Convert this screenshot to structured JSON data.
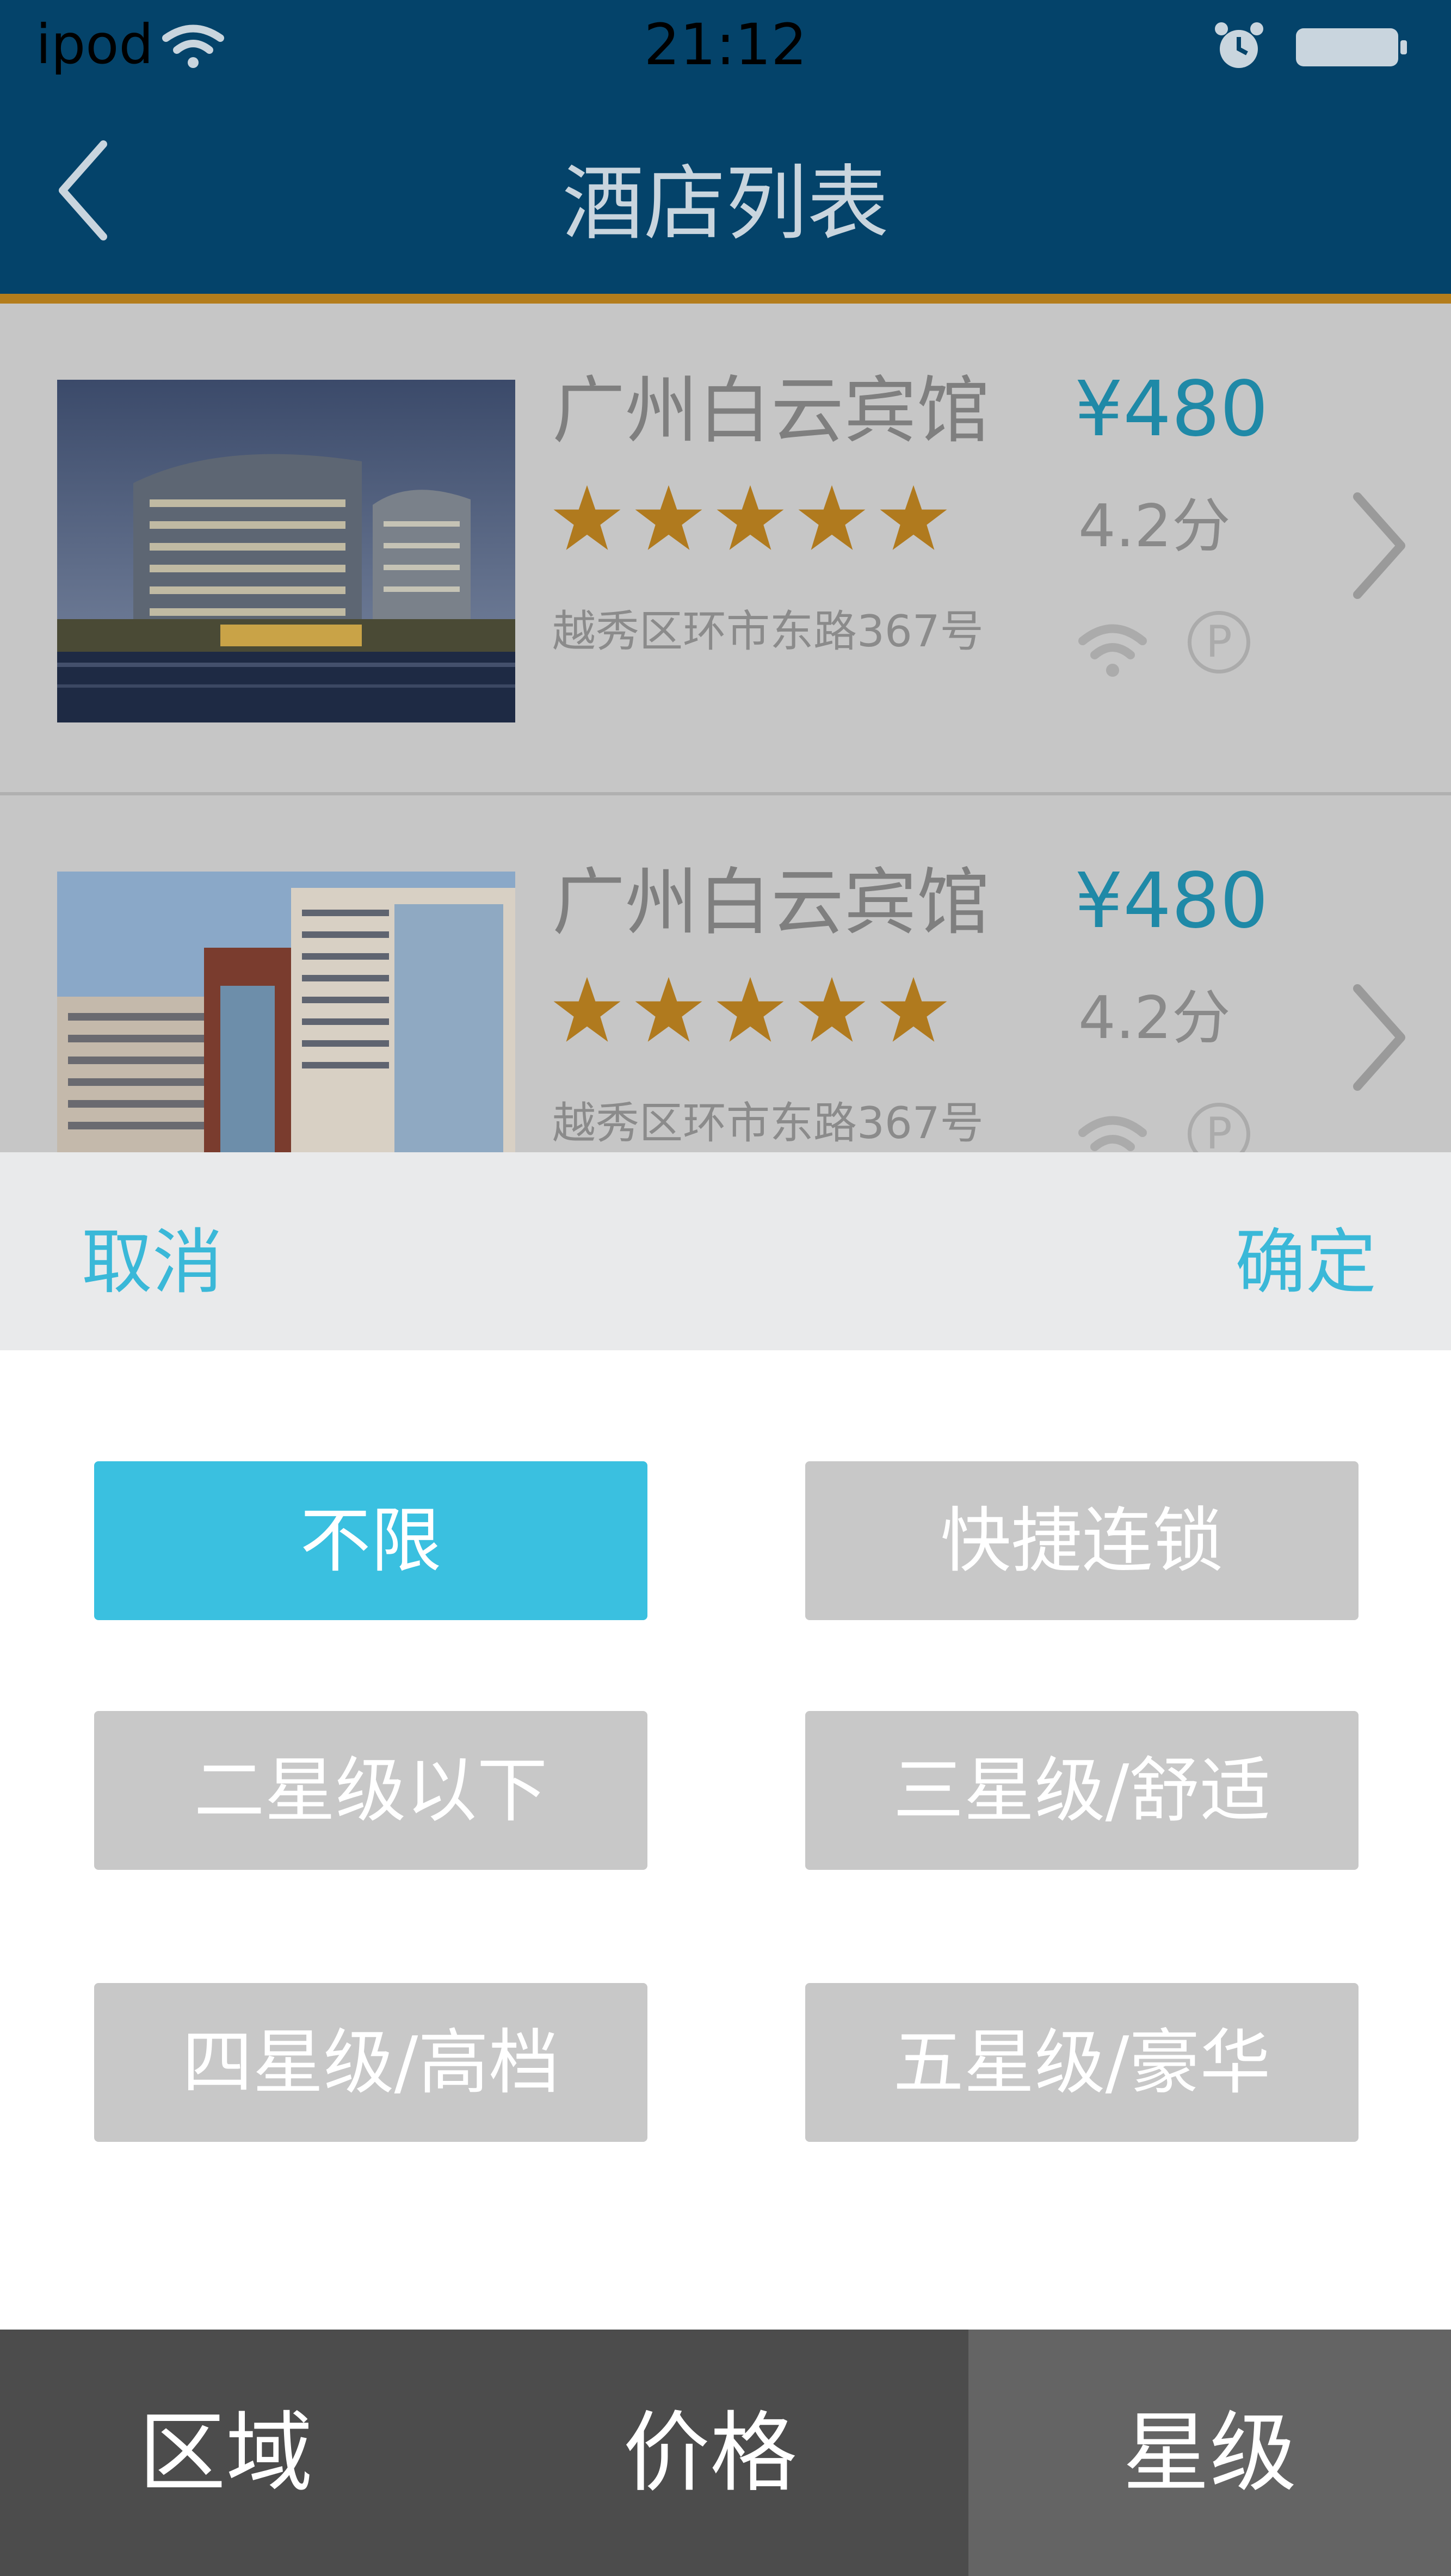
{
  "status_bar": {
    "carrier": "ipod",
    "time": "21:12"
  },
  "nav": {
    "title": "酒店列表",
    "back_icon": "chevron-left-icon"
  },
  "hotels": [
    {
      "name": "广州白云宾馆",
      "rating_stars": 5,
      "address": "越秀区环市东路367号",
      "price": "¥480",
      "score": "4.2分",
      "amenities": [
        "wifi-icon",
        "parking-icon"
      ]
    },
    {
      "name": "广州白云宾馆",
      "rating_stars": 5,
      "address": "越秀区环市东路367号",
      "price": "¥480",
      "score": "4.2分",
      "amenities": [
        "wifi-icon",
        "parking-icon"
      ]
    }
  ],
  "amenity_labels": {
    "parking": "P"
  },
  "sheet": {
    "cancel": "取消",
    "confirm": "确定",
    "options": [
      "不限",
      "快捷连锁",
      "二星级以下",
      "三星级/舒适",
      "四星级/高档",
      "五星级/豪华"
    ],
    "selected": "不限"
  },
  "tabs": [
    {
      "label": "区域",
      "active": false
    },
    {
      "label": "价格",
      "active": false
    },
    {
      "label": "星级",
      "active": true
    }
  ],
  "colors": {
    "nav_bg": "#04436a",
    "accent_line": "#b47d1c",
    "star": "#b07a1e",
    "price": "#1f89a7",
    "primary": "#3ac0e0",
    "tab_bg": "#4c4c4c",
    "tab_active_bg": "#646464"
  }
}
